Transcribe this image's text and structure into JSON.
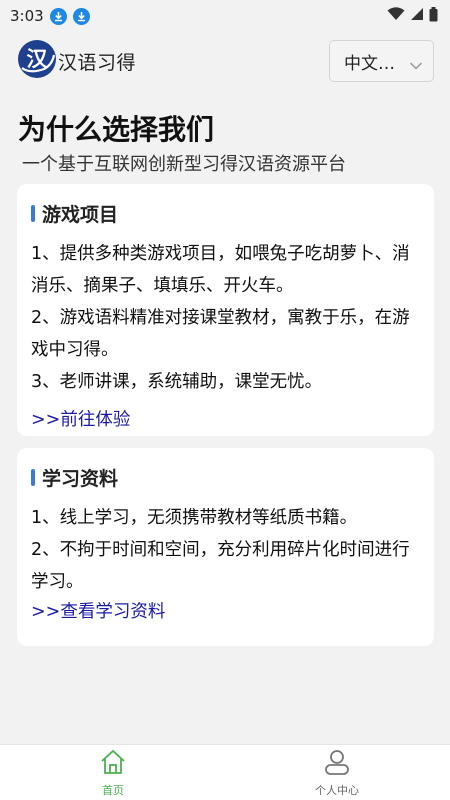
{
  "status_bar": {
    "time": "3:03"
  },
  "header": {
    "logo_char": "汉",
    "app_title": "汉语习得",
    "language_select": "中文…"
  },
  "hero": {
    "title": "为什么选择我们",
    "subtitle": "一个基于互联网创新型习得汉语资源平台"
  },
  "cards": [
    {
      "title": "游戏项目",
      "paragraphs": [
        "1、提供多种类游戏项目，如喂兔子吃胡萝卜、消消乐、摘果子、填填乐、开火车。",
        "2、游戏语料精准对接课堂教材，寓教于乐，在游戏中习得。",
        "3、老师讲课，系统辅助，课堂无忧。"
      ],
      "link": ">>前往体验"
    },
    {
      "title": "学习资料",
      "paragraphs": [
        "1、线上学习，无须携带教材等纸质书籍。",
        "2、不拘于时间和空间，充分利用碎片化时间进行学习。"
      ],
      "link": ">>查看学习资料"
    }
  ],
  "tabbar": {
    "home_label": "首页",
    "profile_label": "个人中心"
  },
  "colors": {
    "accent_bar": "#3a7bd5",
    "link": "#1a1aa6",
    "tab_active": "#4caf50",
    "background": "#f2f2f2"
  }
}
